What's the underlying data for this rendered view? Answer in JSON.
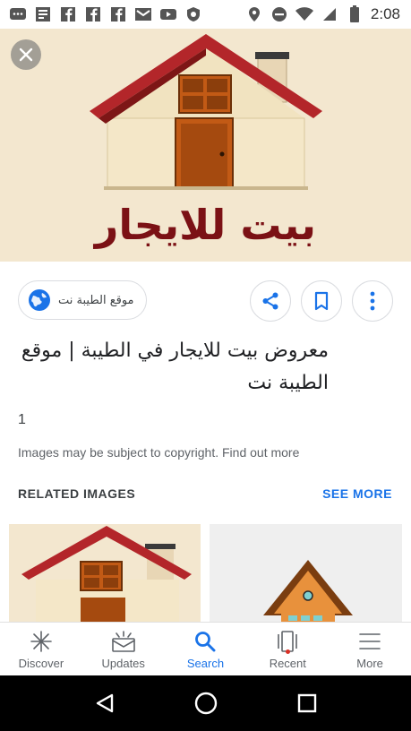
{
  "status_bar": {
    "time": "2:08",
    "left_icons": [
      "messages-icon",
      "news-icon",
      "facebook-icon",
      "facebook-icon",
      "facebook-icon",
      "gmail-icon",
      "youtube-icon",
      "shield-icon"
    ],
    "right_icons": [
      "location-icon",
      "dnd-icon",
      "wifi-icon",
      "signal-icon",
      "battery-icon"
    ]
  },
  "hero": {
    "caption": "بيت للايجار"
  },
  "source": {
    "label": "موقع الطيبة نت"
  },
  "title": {
    "line1": "معروض بيت للايجار في الطيبة | موقع",
    "line2": "الطيبة نت"
  },
  "count": "1",
  "copyright": {
    "text": "Images may be subject to copyright.",
    "link": "Find out more"
  },
  "related": {
    "header": "RELATED IMAGES",
    "see_more": "SEE MORE"
  },
  "bottom_nav": {
    "items": [
      {
        "label": "Discover",
        "icon": "asterisk-icon"
      },
      {
        "label": "Updates",
        "icon": "updates-icon"
      },
      {
        "label": "Search",
        "icon": "search-icon"
      },
      {
        "label": "Recent",
        "icon": "recent-icon"
      },
      {
        "label": "More",
        "icon": "menu-icon"
      }
    ],
    "active": "Search"
  },
  "colors": {
    "accent": "#1a73e8",
    "hero_bg": "#f3e7cf",
    "caption": "#7b1115",
    "roof": "#b3262a"
  }
}
